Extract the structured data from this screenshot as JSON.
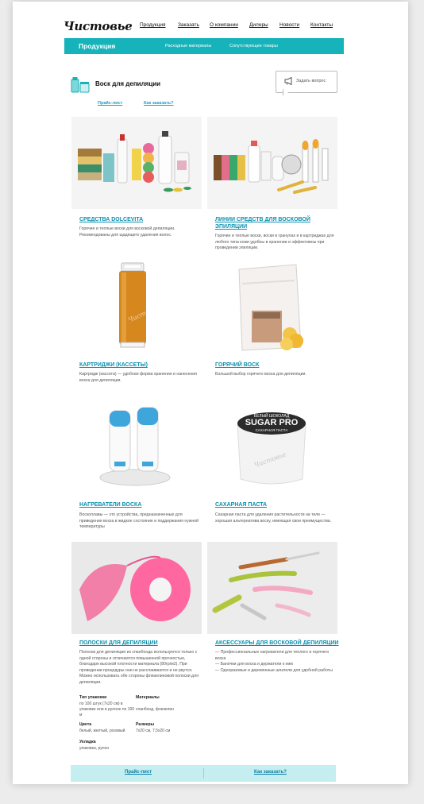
{
  "header": {
    "logo": "Чистовье",
    "nav": [
      "Продукция",
      "Заказать",
      "О компании",
      "Дилеры",
      "Новости",
      "Контакты"
    ]
  },
  "section_bar": {
    "title": "Продукция",
    "sublinks": [
      "Расходные материалы",
      "Сопутствующие товары"
    ]
  },
  "page": {
    "title": "Воск для депиляции",
    "ask_button": "Задать вопрос",
    "links": [
      "Прайс-лист",
      "Как заказать?"
    ]
  },
  "cards": [
    {
      "title": "Средства Dolcevita",
      "desc": "Горячие и теплые воски для восковой депиляции. Рекомендованы для щадящего удаления волос."
    },
    {
      "title": "Линии средств для восковой эпиляции",
      "desc": "Горячие и теплые воски, воски в гранулах и в картриджах для любого типа кожи удобны в хранении и эффективны при проведении эпиляции."
    },
    {
      "title": "Картриджи (кассеты)",
      "desc": "Картридж (кассета) — удобная форма хранения и нанесения воска для депиляции."
    },
    {
      "title": "Горячий воск",
      "desc": "Большой выбор горячего воска для депиляции."
    },
    {
      "title": "Нагреватели воска",
      "desc": "Воскоплавы — это устройства, предназначенные для приведения воска в жидкое состояние и поддержания нужной температуры"
    },
    {
      "title": "Сахарная паста",
      "desc": "Сахарная паста для удаления растительности на теле — хорошая альтернатива воску, имеющая свои преимущества."
    },
    {
      "title": "Полоски для депиляции",
      "desc": "Полоски для депиляции из спанбонда используются только с одной стороны и отличаются повышенной прочностью, благодаря высокой плотности материала (80гр/м2). При проведении процедуры они не расслаиваются и не рвутся. Можно использовать обе стороны флизелиновой полоски для депиляции."
    },
    {
      "title": "Аксессуары для восковой депиляции",
      "desc": "— Профессиональные нагреватели для теплого и горячего воска\n— Баночки для воска и держатели к ним\n— Одноразовые и деревянные шпатели для удобной работы"
    }
  ],
  "specs": {
    "packaging_label": "Тип упаковки",
    "packaging_value": "по 100 штук (7х20 см) в упаковке или в рулоне по 100 м",
    "materials_label": "Материалы",
    "materials_value": "спанбонд, флизелин",
    "colors_label": "Цвета",
    "colors_value": "белый, желтый, розовый",
    "sizes_label": "Размеры",
    "sizes_value": "7х20 см, 7,5х20 см",
    "pack_label": "Укладка",
    "pack_value": "упаковка, рулон"
  },
  "footer": {
    "links": [
      "Прайс-лист",
      "Как заказать?"
    ]
  },
  "images": {
    "jar_label_top": "БЕЛЫЙ ШОКОЛАД",
    "jar_label_main": "SUGAR PRO",
    "jar_label_bottom": "САХАРНАЯ ПАСТА",
    "watermark": "Чистовье"
  },
  "colors": {
    "accent": "#16b3bb",
    "link": "#0a8fae",
    "footer_bg": "#c5eef0"
  }
}
